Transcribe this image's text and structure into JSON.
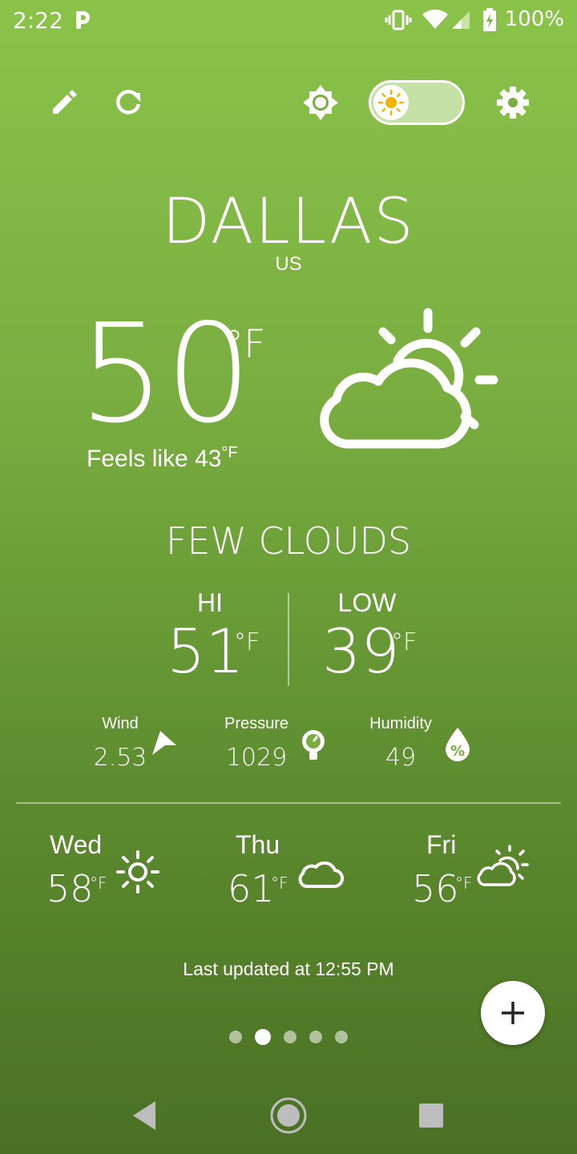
{
  "status_bar": {
    "time": "2:22",
    "battery": "100%",
    "icons": [
      "p-notification-icon",
      "vibrate-icon",
      "wifi-icon",
      "signal-icon",
      "battery-charging-icon"
    ]
  },
  "toolbar": {
    "icons": [
      "edit-icon",
      "refresh-icon",
      "brightness-icon",
      "theme-toggle",
      "settings-icon"
    ],
    "theme_toggle_on": false
  },
  "location": {
    "city": "DALLAS",
    "country": "US"
  },
  "current": {
    "temp": "50",
    "unit": "°F",
    "feels_like_label": "Feels like 43",
    "feels_like_unit": "°F",
    "condition": "FEW CLOUDS",
    "icon": "few-clouds-icon"
  },
  "hi_low": {
    "hi_label": "HI",
    "hi_value": "51",
    "hi_unit": "°F",
    "low_label": "LOW",
    "low_value": "39",
    "low_unit": "°F"
  },
  "metrics": {
    "wind_label": "Wind",
    "wind_value": "2.53",
    "wind_icon": "wind-direction-icon",
    "pressure_label": "Pressure",
    "pressure_value": "1029",
    "pressure_icon": "pressure-gauge-icon",
    "humidity_label": "Humidity",
    "humidity_value": "49",
    "humidity_icon": "humidity-icon"
  },
  "forecast": [
    {
      "day": "Wed",
      "temp": "58",
      "unit": "°F",
      "icon": "sun-icon"
    },
    {
      "day": "Thu",
      "temp": "61",
      "unit": "°F",
      "icon": "cloud-icon"
    },
    {
      "day": "Fri",
      "temp": "56",
      "unit": "°F",
      "icon": "partly-cloudy-icon"
    }
  ],
  "last_updated": "Last updated at 12:55 PM",
  "pager": {
    "count": 5,
    "active_index": 1
  },
  "colors": {
    "background_top": "#8bc34a",
    "background_bottom": "#4a7024",
    "text": "#ffffff",
    "toggle_track": "#c5e1a5",
    "sun": "#f4b400"
  }
}
